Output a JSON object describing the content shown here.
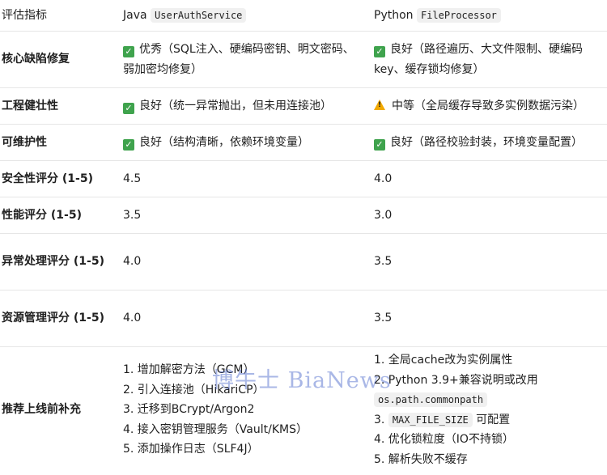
{
  "header": {
    "col1": "评估指标",
    "java_lang": "Java",
    "java_class": "UserAuthService",
    "python_lang": "Python",
    "python_class": "FileProcessor"
  },
  "rows": [
    {
      "label": "核心缺陷修复",
      "java": {
        "icon": "check-icon",
        "text": "优秀（SQL注入、硬编码密钥、明文密码、弱加密均修复）"
      },
      "python": {
        "icon": "check-icon",
        "text": "良好（路径遍历、大文件限制、硬编码key、缓存锁均修复）"
      }
    },
    {
      "label": "工程健壮性",
      "java": {
        "icon": "check-icon",
        "text": "良好（统一异常抛出，但未用连接池）"
      },
      "python": {
        "icon": "warning-icon",
        "text": "中等（全局缓存导致多实例数据污染）"
      }
    },
    {
      "label": "可维护性",
      "java": {
        "icon": "check-icon",
        "text": "良好（结构清晰，依赖环境变量）"
      },
      "python": {
        "icon": "check-icon",
        "text": "良好（路径校验封装，环境变量配置）"
      }
    },
    {
      "label": "安全性评分 (1-5)",
      "java": {
        "text": "4.5"
      },
      "python": {
        "text": "4.0"
      }
    },
    {
      "label": "性能评分 (1-5)",
      "java": {
        "text": "3.5"
      },
      "python": {
        "text": "3.0"
      }
    },
    {
      "label": "异常处理评分 (1-5)",
      "java": {
        "text": "4.0"
      },
      "python": {
        "text": "3.5"
      }
    },
    {
      "label": "资源管理评分 (1-5)",
      "java": {
        "text": "4.0"
      },
      "python": {
        "text": "3.5"
      }
    }
  ],
  "recommend": {
    "label": "推荐上线前补充",
    "java": [
      "1. 增加解密方法（GCM）",
      "2. 引入连接池（HikariCP）",
      "3. 迁移到BCrypt/Argon2",
      "4. 接入密钥管理服务（Vault/KMS）",
      "5. 添加操作日志（SLF4J）"
    ],
    "python": {
      "item1": "1. 全局cache改为实例属性",
      "item2": "2. Python 3.9+兼容说明或改用",
      "item2_code": "os.path.commonpath",
      "item3_prefix": "3. ",
      "item3_code": "MAX_FILE_SIZE",
      "item3_suffix": " 可配置",
      "item4": "4. 优化锁粒度（IO不持锁）",
      "item5": "5. 解析失败不缓存"
    }
  },
  "watermark": "博牛士 BiaNews"
}
